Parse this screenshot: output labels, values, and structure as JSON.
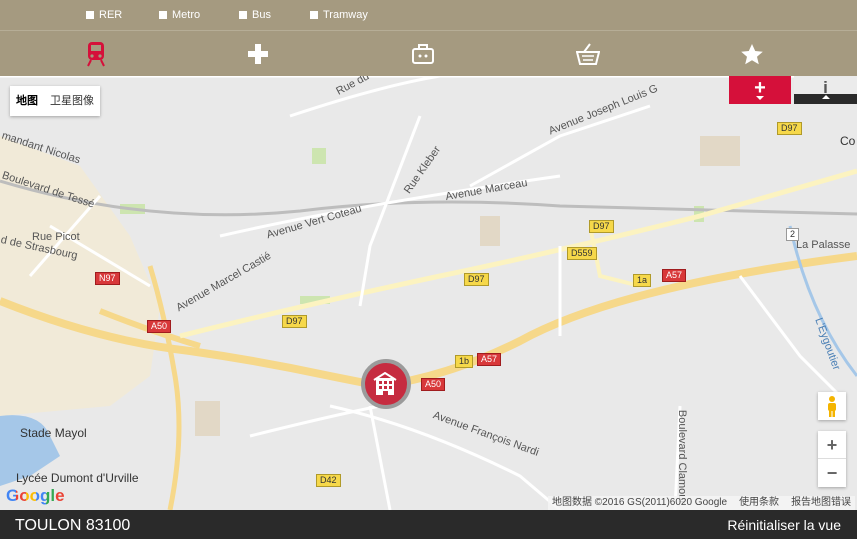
{
  "filters": [
    {
      "label": "RER"
    },
    {
      "label": "Metro"
    },
    {
      "label": "Bus"
    },
    {
      "label": "Tramway"
    }
  ],
  "categories": [
    {
      "icon": "train-icon",
      "active": true
    },
    {
      "icon": "medical-cross-icon"
    },
    {
      "icon": "briefcase-icon"
    },
    {
      "icon": "shopping-basket-icon"
    },
    {
      "icon": "star-icon"
    }
  ],
  "map": {
    "type_buttons": [
      "地图",
      "卫星图像"
    ],
    "streets": [
      "Rue du",
      "Avenue Joseph Louis G",
      "Rue Kleber",
      "Avenue Marceau",
      "Avenue Vert Coteau",
      "Avenue Marcel Castié",
      "Rue Picot",
      "d de Strasbourg",
      "Boulevard de Tessé",
      "mandant Nicolas",
      "Avenue François Nardi",
      "Boulevard Clamour",
      "L'Eygoutier",
      "La Palasse",
      "Co",
      "Stade Mayol",
      "Lycée Dumont d'Urville"
    ],
    "shields": [
      "D97",
      "D97",
      "D97",
      "D97",
      "D559",
      "A57",
      "A57",
      "A50",
      "A50",
      "N97",
      "D42",
      "1a",
      "1b",
      "2"
    ],
    "attribution": [
      "地图数据 ©2016 GS(2011)6020 Google",
      "使用条款",
      "报告地图错误"
    ],
    "logo": "Google",
    "zoom_in": "+",
    "zoom_out": "−"
  },
  "controls": {
    "plus_label": "+",
    "info_label": "i"
  },
  "footer": {
    "city": "TOULON 83100",
    "reset": "Réinitialiser la vue"
  },
  "colors": {
    "header_bg": "#a59a80",
    "accent": "#d5103a",
    "footer_bg": "#2a2a2a",
    "active_icon": "#d5103a"
  }
}
